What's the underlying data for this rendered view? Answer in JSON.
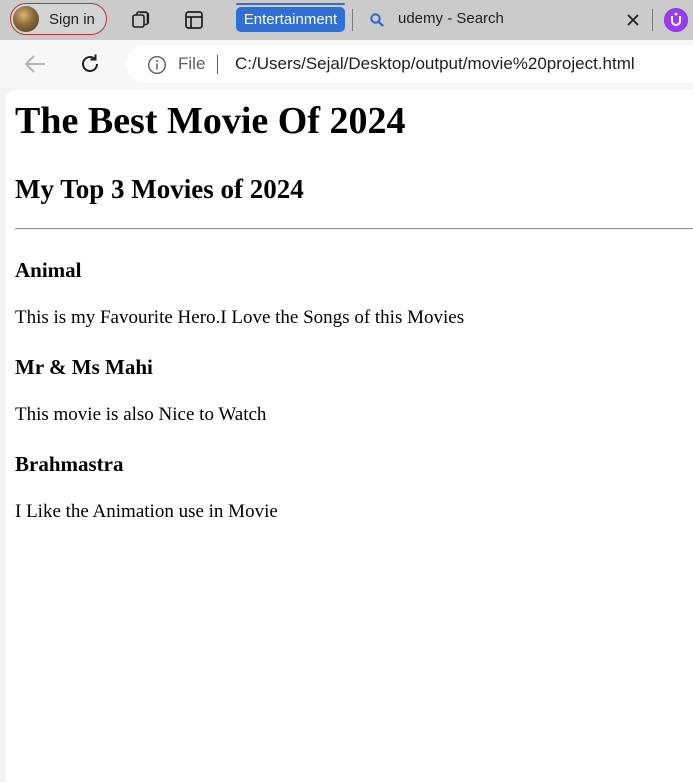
{
  "browser": {
    "profile_button_label": "Sign in",
    "tab_group_label": "Entertainment",
    "tab_group_color": "#2f6fd6",
    "active_tab_title": "udemy - Search",
    "address": {
      "scheme_label": "File",
      "url": "C:/Users/Sejal/Desktop/output/movie%20project.html"
    },
    "icons": {
      "profile": "avatar-icon",
      "workspaces": "workspaces-icon",
      "tab_actions": "tab-actions-icon",
      "tab_favicon": "search-icon",
      "close_tab": "close-icon",
      "extension": "extension-icon",
      "back": "back-arrow-icon",
      "reload": "reload-icon",
      "site_info": "info-icon"
    }
  },
  "page": {
    "heading": "The Best Movie Of 2024",
    "subheading": "My Top 3 Movies of 2024",
    "movies": [
      {
        "title": "Animal",
        "description": "This is my Favourite Hero.I Love the Songs of this Movies"
      },
      {
        "title": "Mr & Ms Mahi",
        "description": "This movie is also Nice to Watch"
      },
      {
        "title": "Brahmastra",
        "description": "I Like the Animation use in Movie"
      }
    ]
  }
}
